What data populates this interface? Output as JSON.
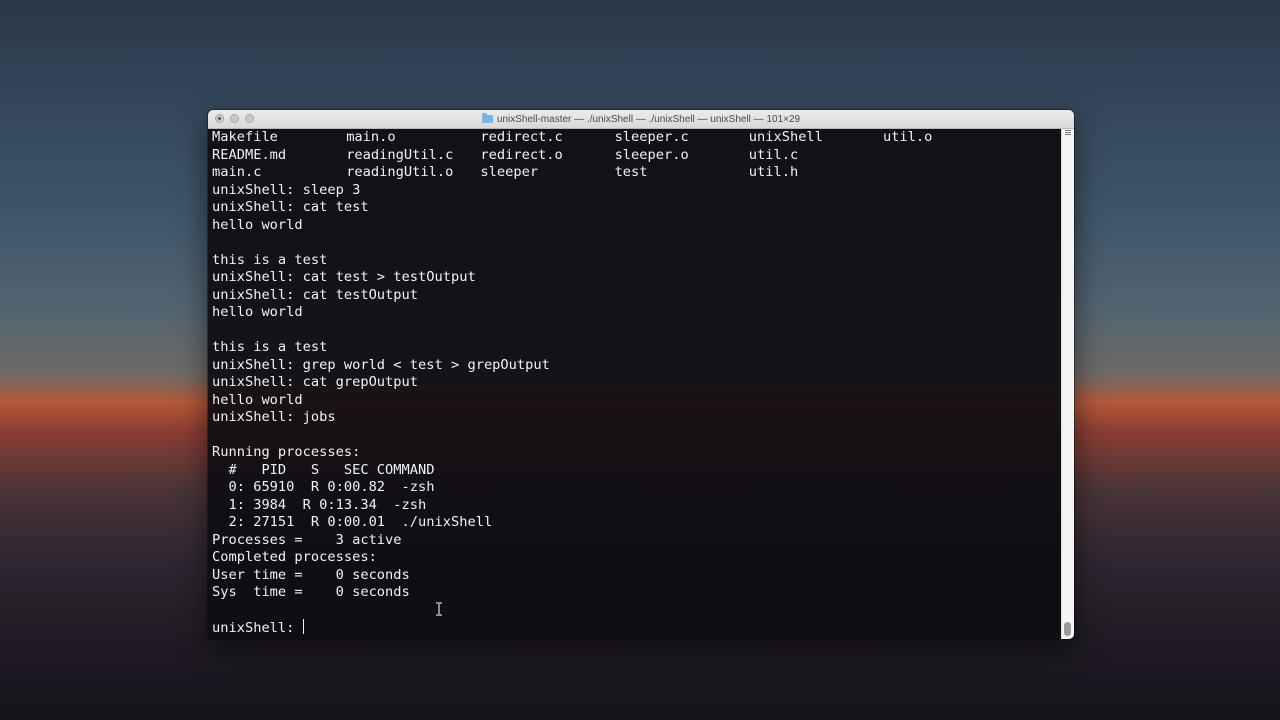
{
  "window": {
    "title": "unixShell-master — ./unixShell — ./unixShell — unixShell — 101×29",
    "folder_icon": "folder-icon"
  },
  "terminal": {
    "ls_rows": [
      [
        "Makefile",
        "main.o",
        "redirect.c",
        "sleeper.c",
        "unixShell",
        "util.o"
      ],
      [
        "README.md",
        "readingUtil.c",
        "redirect.o",
        "sleeper.o",
        "util.c",
        ""
      ],
      [
        "main.c",
        "readingUtil.o",
        "sleeper",
        "test",
        "util.h",
        ""
      ]
    ],
    "lines": [
      "unixShell: sleep 3",
      "unixShell: cat test",
      "hello world",
      "",
      "this is a test",
      "unixShell: cat test > testOutput",
      "unixShell: cat testOutput",
      "hello world",
      "",
      "this is a test",
      "unixShell: grep world < test > grepOutput",
      "unixShell: cat grepOutput",
      "hello world",
      "unixShell: jobs",
      "",
      "Running processes:",
      "  #   PID   S   SEC COMMAND",
      "  0: 65910  R 0:00.82  -zsh",
      "  1: 3984  R 0:13.34  -zsh",
      "  2: 27151  R 0:00.01  ./unixShell",
      "Processes =    3 active",
      "Completed processes:",
      "User time =    0 seconds",
      "Sys  time =    0 seconds",
      ""
    ],
    "prompt": "unixShell: "
  },
  "colors": {
    "terminal_text": "#f2f2f2",
    "terminal_background": "#0e0d12"
  }
}
